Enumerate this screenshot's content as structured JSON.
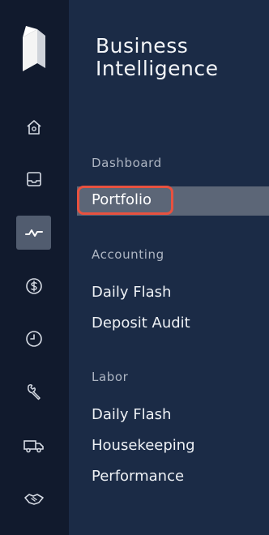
{
  "app": {
    "title": "Business Intelligence"
  },
  "rail": {
    "items": [
      {
        "icon": "home-icon",
        "active": false
      },
      {
        "icon": "inbox-icon",
        "active": false
      },
      {
        "icon": "activity-icon",
        "active": true
      },
      {
        "icon": "dollar-coin-icon",
        "active": false
      },
      {
        "icon": "clock-icon",
        "active": false
      },
      {
        "icon": "wrench-icon",
        "active": false
      },
      {
        "icon": "truck-icon",
        "active": false
      },
      {
        "icon": "handshake-icon",
        "active": false
      }
    ]
  },
  "nav": {
    "sections": [
      {
        "label": "Dashboard",
        "items": [
          "Portfolio"
        ]
      },
      {
        "label": "Accounting",
        "items": [
          "Daily Flash",
          "Deposit Audit"
        ]
      },
      {
        "label": "Labor",
        "items": [
          "Daily Flash",
          "Housekeeping",
          "Performance"
        ]
      }
    ],
    "active_item": "Portfolio"
  },
  "colors": {
    "rail_bg": "#111a2d",
    "panel_bg": "#1b2b46",
    "highlight_border": "#e8513f",
    "active_bg": "#5c6677"
  }
}
